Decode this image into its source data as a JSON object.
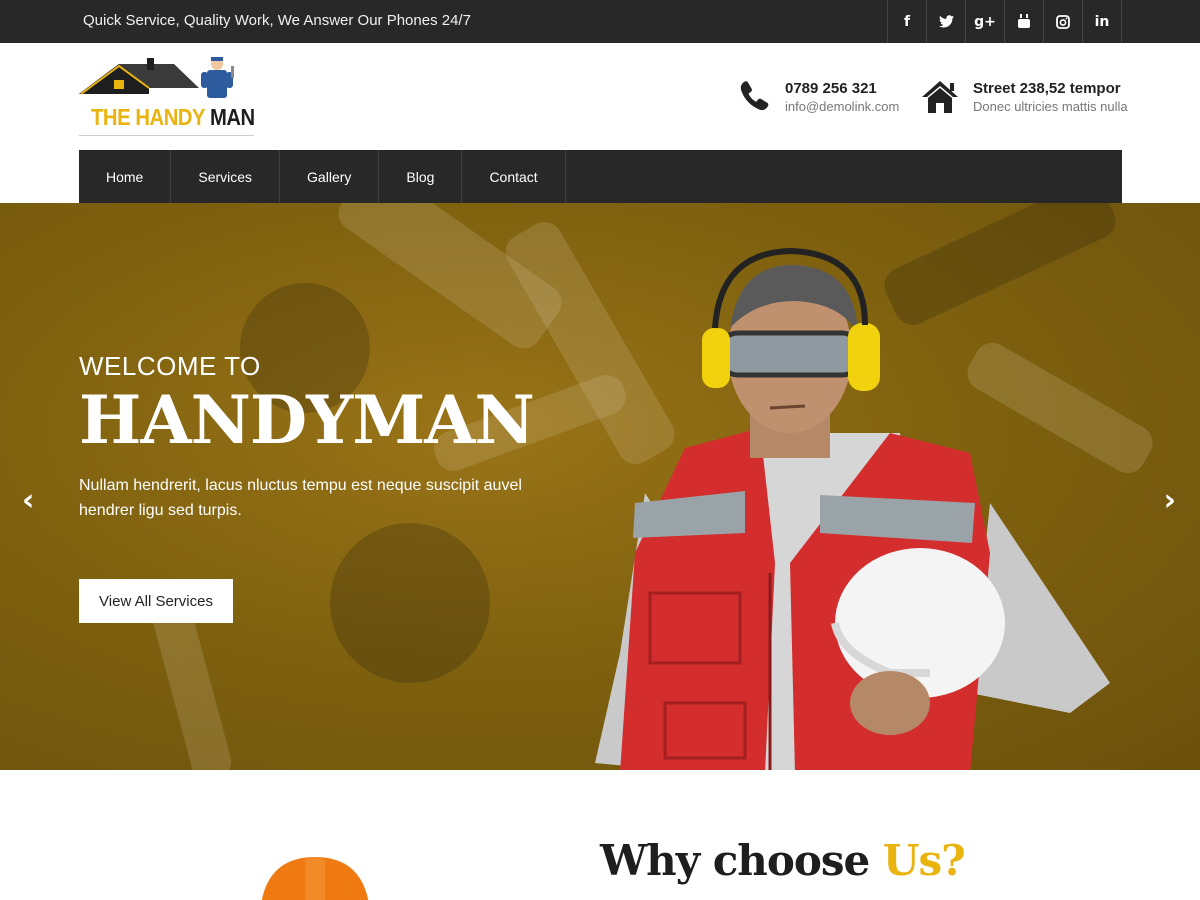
{
  "topbar": {
    "tagline": "Quick Service, Quality Work, We Answer Our Phones 24/7",
    "social": [
      {
        "icon": "facebook-icon",
        "glyph": "f"
      },
      {
        "icon": "twitter-icon",
        "glyph": "t"
      },
      {
        "icon": "google-plus-icon",
        "glyph": "g+"
      },
      {
        "icon": "youtube-icon",
        "glyph": "▶"
      },
      {
        "icon": "instagram-icon",
        "glyph": "◎"
      },
      {
        "icon": "linkedin-icon",
        "glyph": "in"
      }
    ]
  },
  "logo": {
    "word1": "THE HANDY",
    "word2": "MAN"
  },
  "contact": {
    "phone": "0789 256 321",
    "email": "info@demolink.com",
    "address": "Street 238,52 tempor",
    "address_sub": "Donec ultricies mattis nulla"
  },
  "nav": {
    "items": [
      "Home",
      "Services",
      "Gallery",
      "Blog",
      "Contact"
    ]
  },
  "hero": {
    "welcome": "WELCOME TO",
    "title": "HANDYMAN",
    "description": "Nullam hendrerit, lacus nluctus tempu est neque suscipit auvel hendrer ligu sed turpis.",
    "button": "View All Services",
    "prev": "‹",
    "next": "›"
  },
  "why": {
    "title_part1": "Why choose ",
    "title_part2": "Us?"
  },
  "colors": {
    "accent": "#e9b310",
    "dark": "#282828",
    "hero_bg": "#80620f"
  }
}
